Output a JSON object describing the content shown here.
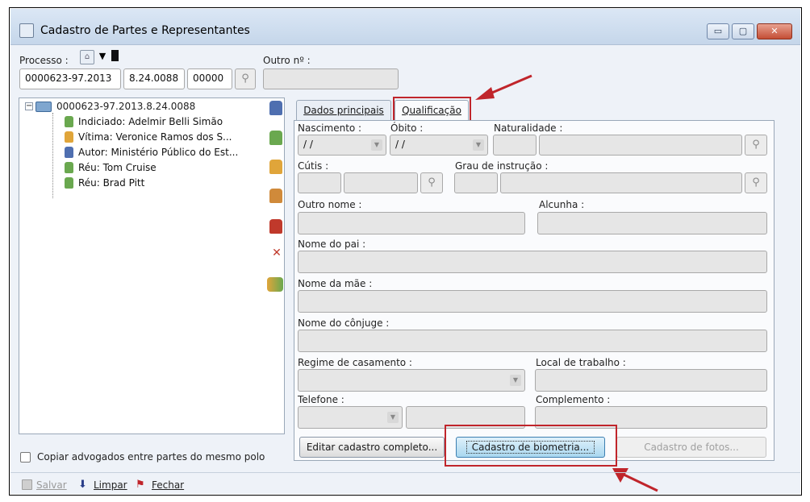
{
  "window": {
    "title": "Cadastro de Partes e Representantes",
    "minimize": "▭",
    "maximize": "▢",
    "close": "✕"
  },
  "processo": {
    "label": "Processo :",
    "seg1": "0000623-97.2013",
    "seg2": "8.24.0088",
    "seg3": "00000",
    "outro_label": "Outro nº :",
    "outro_value": ""
  },
  "tree": {
    "root": "0000623-97.2013.8.24.0088",
    "items": [
      {
        "label": "Indiciado: Adelmir Belli Simão",
        "color": "#6aa84f"
      },
      {
        "label": "Vítima: Veronice Ramos dos S...",
        "color": "#e0a53a"
      },
      {
        "label": "Autor: Ministério Público do Est...",
        "color": "#4f6fb0"
      },
      {
        "label": "Réu: Tom Cruise",
        "color": "#6aa84f"
      },
      {
        "label": "Réu: Brad Pitt",
        "color": "#6aa84f"
      }
    ],
    "copiar_label": "Copiar advogados entre partes do mesmo polo"
  },
  "tabs": {
    "dados": "Dados principais",
    "qualificacao": "Qualificação"
  },
  "form": {
    "nascimento": "Nascimento :",
    "obito": "Óbito :",
    "naturalidade": "Naturalidade :",
    "date_placeholder": "/ /",
    "cutis": "Cútis :",
    "grau": "Grau de instrução :",
    "outro_nome": "Outro nome :",
    "alcunha": "Alcunha :",
    "nome_pai": "Nome do pai :",
    "nome_mae": "Nome da mãe :",
    "nome_conjuge": "Nome do cônjuge :",
    "regime": "Regime de casamento :",
    "local_trabalho": "Local de trabalho :",
    "telefone": "Telefone :",
    "complemento": "Complemento :"
  },
  "buttons": {
    "editar": "Editar cadastro completo...",
    "biometria": "Cadastro de biometria...",
    "fotos": "Cadastro de fotos..."
  },
  "toolbar": {
    "salvar": "Salvar",
    "limpar": "Limpar",
    "fechar": "Fechar"
  },
  "colors": {
    "annotation_red": "#c0252b"
  }
}
